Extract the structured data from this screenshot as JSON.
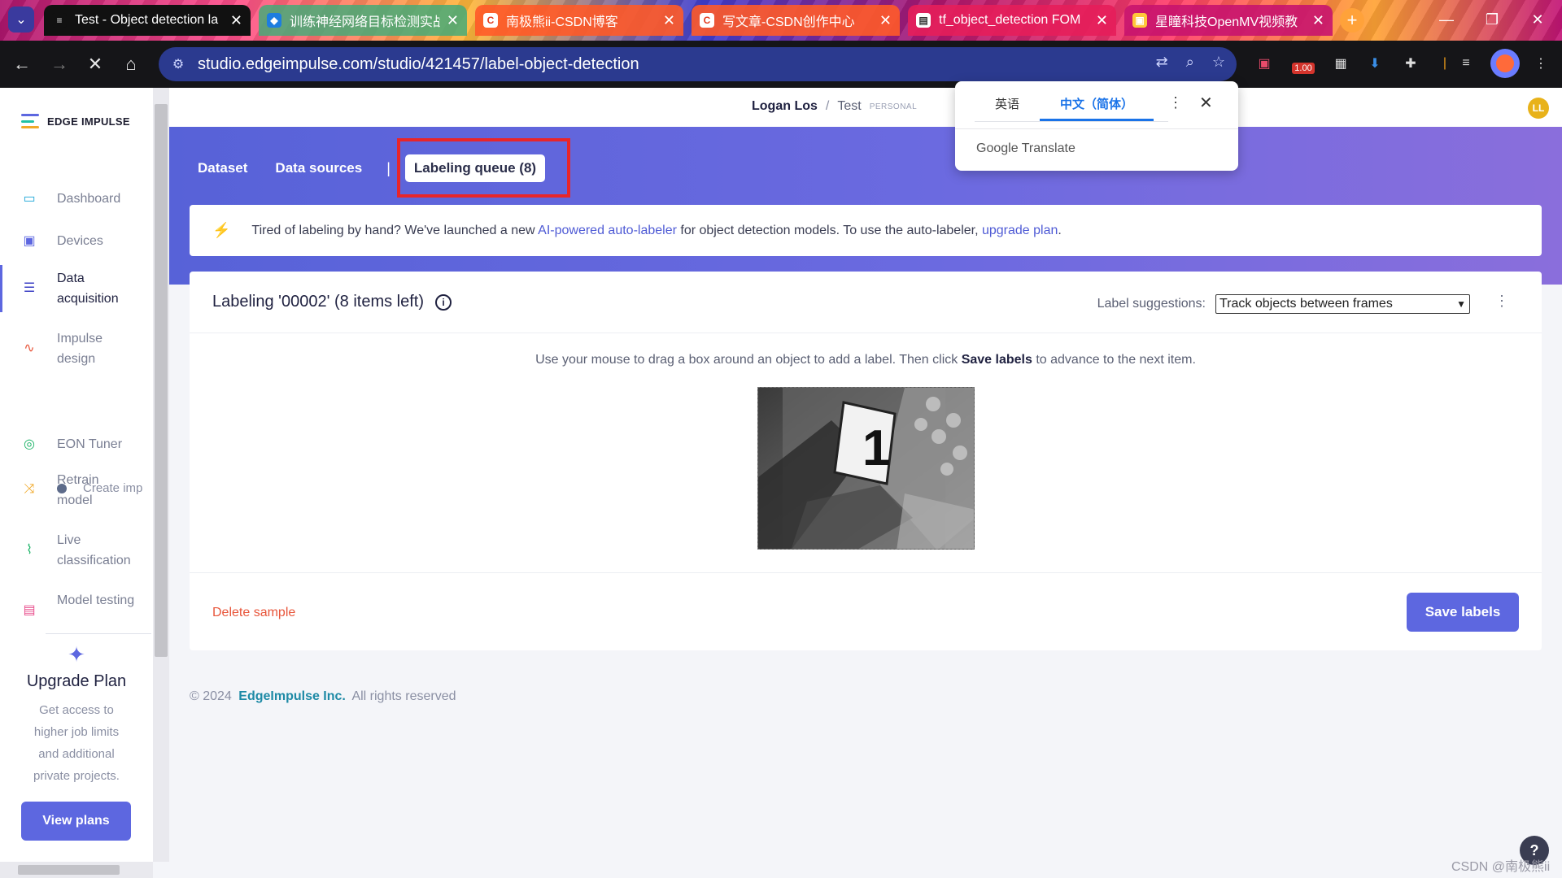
{
  "browser": {
    "tabs": [
      {
        "title": "Test - Object detection la",
        "active": true
      },
      {
        "title": "训练神经网络目标检测实战"
      },
      {
        "title": "南极熊ii-CSDN博客"
      },
      {
        "title": "写文章-CSDN创作中心"
      },
      {
        "title": "tf_object_detection FOM"
      },
      {
        "title": "星瞳科技OpenMV视频教"
      }
    ],
    "url": "studio.edgeimpulse.com/studio/421457/label-object-detection",
    "extension_badge": "1.00"
  },
  "sidebar": {
    "logo_text": "EDGE IMPULSE",
    "items": [
      {
        "label": "Dashboard",
        "icon": "monitor-icon"
      },
      {
        "label": "Devices",
        "icon": "chip-icon"
      },
      {
        "label": "Data acquisition",
        "icon": "database-icon"
      },
      {
        "label": "Impulse design",
        "icon": "pulse-icon"
      },
      {
        "label": "EON Tuner",
        "icon": "compass-icon"
      },
      {
        "label": "Retrain model",
        "icon": "shuffle-icon"
      },
      {
        "label": "Live classification",
        "icon": "wave-icon"
      },
      {
        "label": "Model testing",
        "icon": "clipboard-icon"
      }
    ],
    "sub_item": "Create imp",
    "upgrade": {
      "title": "Upgrade Plan",
      "text": "Get access to higher job limits and additional private projects.",
      "button": "View plans"
    }
  },
  "topbar": {
    "owner": "Logan Los",
    "separator": "/",
    "project": "Test",
    "tag": "PERSONAL",
    "avatar_initials": "LL"
  },
  "subnav": {
    "dataset": "Dataset",
    "data_sources": "Data sources",
    "separator": "|",
    "labeling_queue": "Labeling queue (8)"
  },
  "banner": {
    "text_before": "Tired of labeling by hand? We've launched a new",
    "link1": "AI-powered auto-labeler",
    "text_middle": "for object detection models. To use the auto-labeler,",
    "link2": "upgrade plan",
    "text_end": "."
  },
  "labeling": {
    "title": "Labeling '00002' (8 items left)",
    "suggestions_label": "Label suggestions:",
    "suggestions_value": "Track objects between frames",
    "instruction_before": "Use your mouse to drag a box around an object to add a label. Then click",
    "instruction_bold": "Save labels",
    "instruction_after": "to advance to the next item.",
    "delete_label": "Delete sample",
    "save_label": "Save labels"
  },
  "footer": {
    "copyright": "© 2024",
    "company": "EdgeImpulse Inc.",
    "rights": "All rights reserved"
  },
  "translate_popup": {
    "tab1": "英语",
    "tab2": "中文（简体）",
    "brand": "Google Translate"
  },
  "watermark": "CSDN @南极熊ii"
}
